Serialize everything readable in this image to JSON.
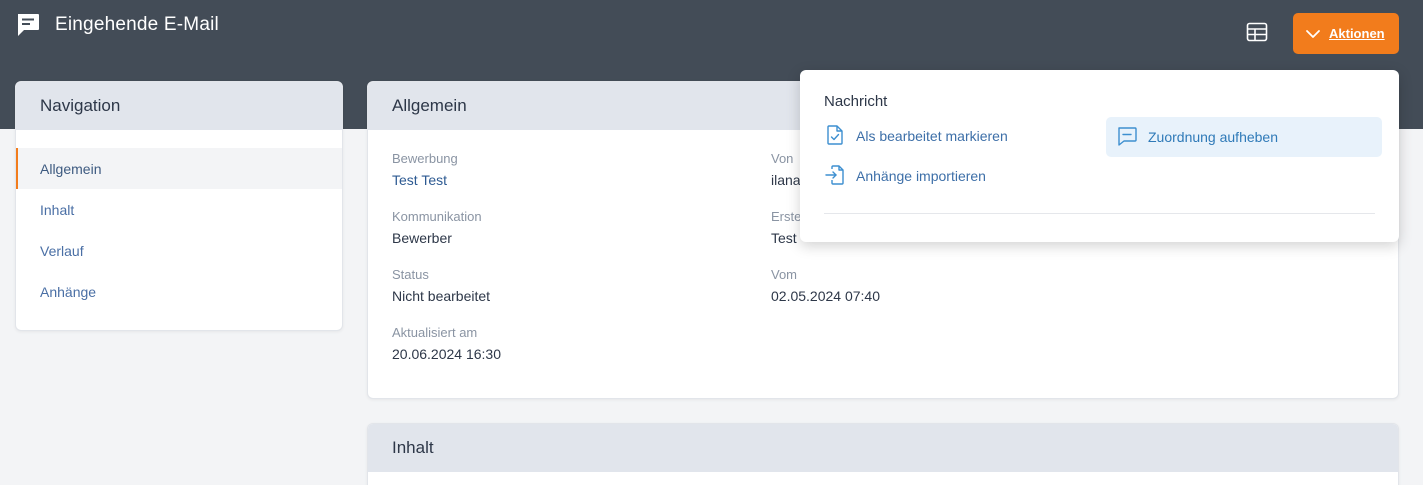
{
  "header": {
    "title": "Eingehende E-Mail",
    "app_icon": "message-square-icon",
    "table_icon": "table-layout-icon",
    "actions_label": "Aktionen",
    "actions_icon": "chevron-down-icon",
    "accent_color": "#f27c1c",
    "bar_color": "#434c57"
  },
  "navigation": {
    "title": "Navigation",
    "items": [
      {
        "label": "Allgemein",
        "active": true
      },
      {
        "label": "Inhalt",
        "active": false
      },
      {
        "label": "Verlauf",
        "active": false
      },
      {
        "label": "Anhänge",
        "active": false
      }
    ]
  },
  "general": {
    "title": "Allgemein",
    "fields": {
      "bewerbung": {
        "label": "Bewerbung",
        "value": "Test Test"
      },
      "von": {
        "label": "Von",
        "value": "ilana"
      },
      "kommunikation": {
        "label": "Kommunikation",
        "value": "Bewerber"
      },
      "erstellt": {
        "label": "Erste",
        "value": "Test"
      },
      "status": {
        "label": "Status",
        "value": "Nicht bearbeitet"
      },
      "vom": {
        "label": "Vom",
        "value": "02.05.2024 07:40"
      },
      "aktualisiert": {
        "label": "Aktualisiert am",
        "value": "20.06.2024 16:30"
      }
    }
  },
  "content": {
    "title": "Inhalt"
  },
  "dropdown": {
    "section_title": "Nachricht",
    "items": [
      {
        "label": "Als bearbeitet markieren",
        "icon": "file-check-icon"
      },
      {
        "label": "Zuordnung aufheben",
        "icon": "message-square-icon"
      },
      {
        "label": "Anhänge importieren",
        "icon": "file-import-icon"
      }
    ]
  }
}
